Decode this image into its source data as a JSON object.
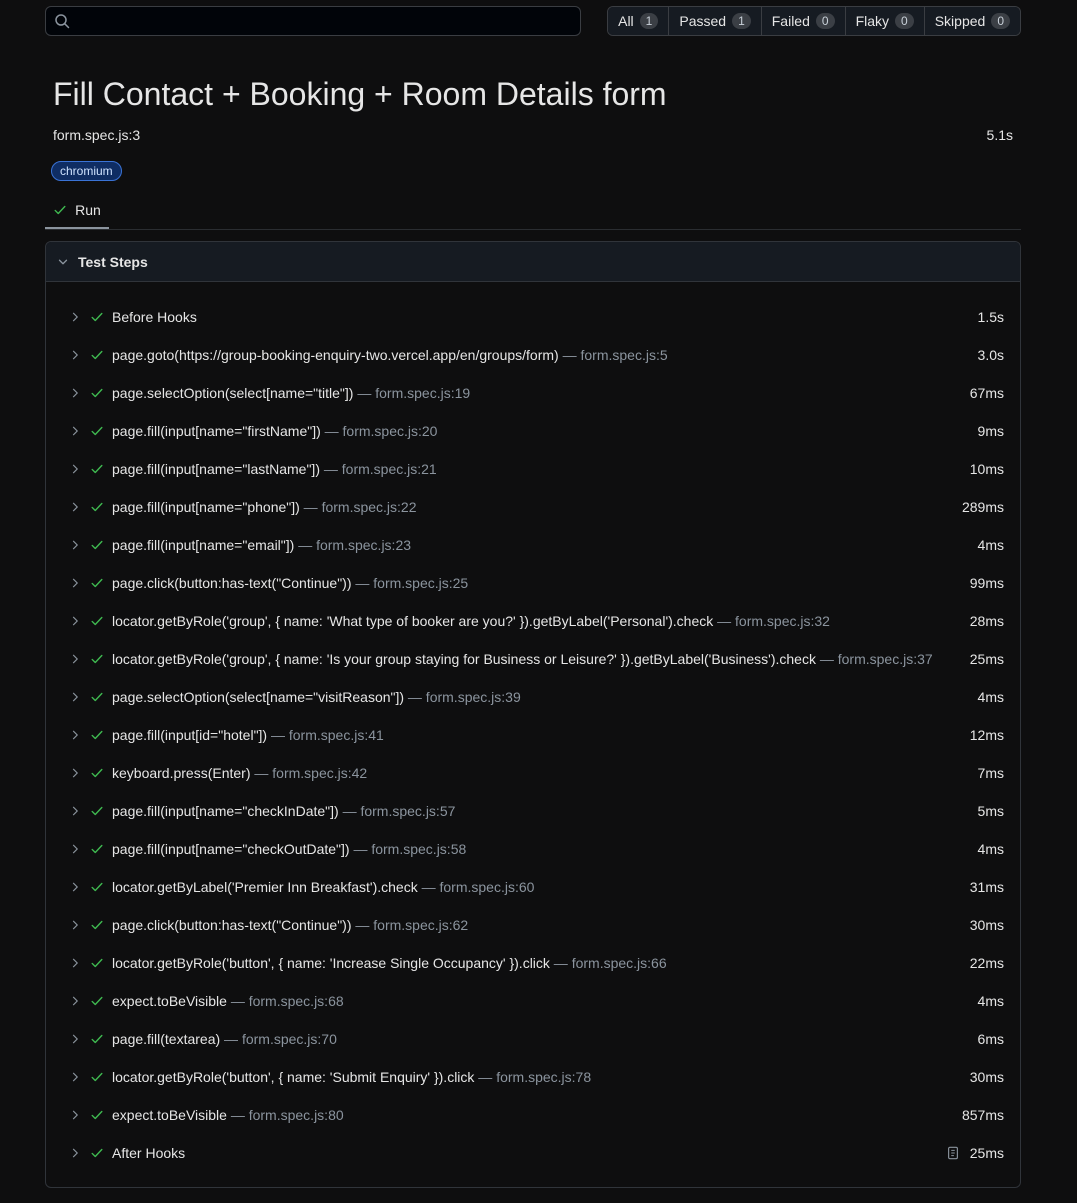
{
  "search": {
    "value": "",
    "placeholder": ""
  },
  "filters": [
    {
      "label": "All",
      "count": "1"
    },
    {
      "label": "Passed",
      "count": "1"
    },
    {
      "label": "Failed",
      "count": "0"
    },
    {
      "label": "Flaky",
      "count": "0"
    },
    {
      "label": "Skipped",
      "count": "0"
    }
  ],
  "test": {
    "title": "Fill Contact + Booking + Room Details form",
    "location": "form.spec.js:3",
    "duration": "5.1s",
    "project": "chromium"
  },
  "tabs": {
    "run": "Run"
  },
  "steps_header": "Test Steps",
  "steps": [
    {
      "title": "Before Hooks",
      "location": "",
      "duration": "1.5s"
    },
    {
      "title": "page.goto(https://group-booking-enquiry-two.vercel.app/en/groups/form)",
      "location": " — form.spec.js:5",
      "duration": "3.0s"
    },
    {
      "title": "page.selectOption(select[name=\"title\"])",
      "location": " — form.spec.js:19",
      "duration": "67ms"
    },
    {
      "title": "page.fill(input[name=\"firstName\"])",
      "location": " — form.spec.js:20",
      "duration": "9ms"
    },
    {
      "title": "page.fill(input[name=\"lastName\"])",
      "location": " — form.spec.js:21",
      "duration": "10ms"
    },
    {
      "title": "page.fill(input[name=\"phone\"])",
      "location": " — form.spec.js:22",
      "duration": "289ms"
    },
    {
      "title": "page.fill(input[name=\"email\"])",
      "location": " — form.spec.js:23",
      "duration": "4ms"
    },
    {
      "title": "page.click(button:has-text(\"Continue\"))",
      "location": " — form.spec.js:25",
      "duration": "99ms"
    },
    {
      "title": "locator.getByRole('group', { name: 'What type of booker are you?' }).getByLabel('Personal').check",
      "location": " — form.spec.js:32",
      "duration": "28ms"
    },
    {
      "title": "locator.getByRole('group', { name: 'Is your group staying for Business or Leisure?' }).getByLabel('Business').check",
      "location": " — form.spec.js:37",
      "duration": "25ms"
    },
    {
      "title": "page.selectOption(select[name=\"visitReason\"])",
      "location": " — form.spec.js:39",
      "duration": "4ms"
    },
    {
      "title": "page.fill(input[id=\"hotel\"])",
      "location": " — form.spec.js:41",
      "duration": "12ms"
    },
    {
      "title": "keyboard.press(Enter)",
      "location": " — form.spec.js:42",
      "duration": "7ms"
    },
    {
      "title": "page.fill(input[name=\"checkInDate\"])",
      "location": " — form.spec.js:57",
      "duration": "5ms"
    },
    {
      "title": "page.fill(input[name=\"checkOutDate\"])",
      "location": " — form.spec.js:58",
      "duration": "4ms"
    },
    {
      "title": "locator.getByLabel('Premier Inn Breakfast').check",
      "location": " — form.spec.js:60",
      "duration": "31ms"
    },
    {
      "title": "page.click(button:has-text(\"Continue\"))",
      "location": " — form.spec.js:62",
      "duration": "30ms"
    },
    {
      "title": "locator.getByRole('button', { name: 'Increase Single Occupancy' }).click",
      "location": " — form.spec.js:66",
      "duration": "22ms"
    },
    {
      "title": "expect.toBeVisible",
      "location": " — form.spec.js:68",
      "duration": "4ms"
    },
    {
      "title": "page.fill(textarea)",
      "location": " — form.spec.js:70",
      "duration": "6ms"
    },
    {
      "title": "locator.getByRole('button', { name: 'Submit Enquiry' }).click",
      "location": " — form.spec.js:78",
      "duration": "30ms"
    },
    {
      "title": "expect.toBeVisible",
      "location": " — form.spec.js:80",
      "duration": "857ms"
    },
    {
      "title": "After Hooks",
      "location": "",
      "duration": "25ms",
      "attachment_icon": "attachment-icon"
    }
  ],
  "colors": {
    "background": "#0e0e0f",
    "success": "#3fb950",
    "muted": "#8b949e",
    "badge_bg": "#0f2d63",
    "badge_border": "#3a73d6"
  }
}
